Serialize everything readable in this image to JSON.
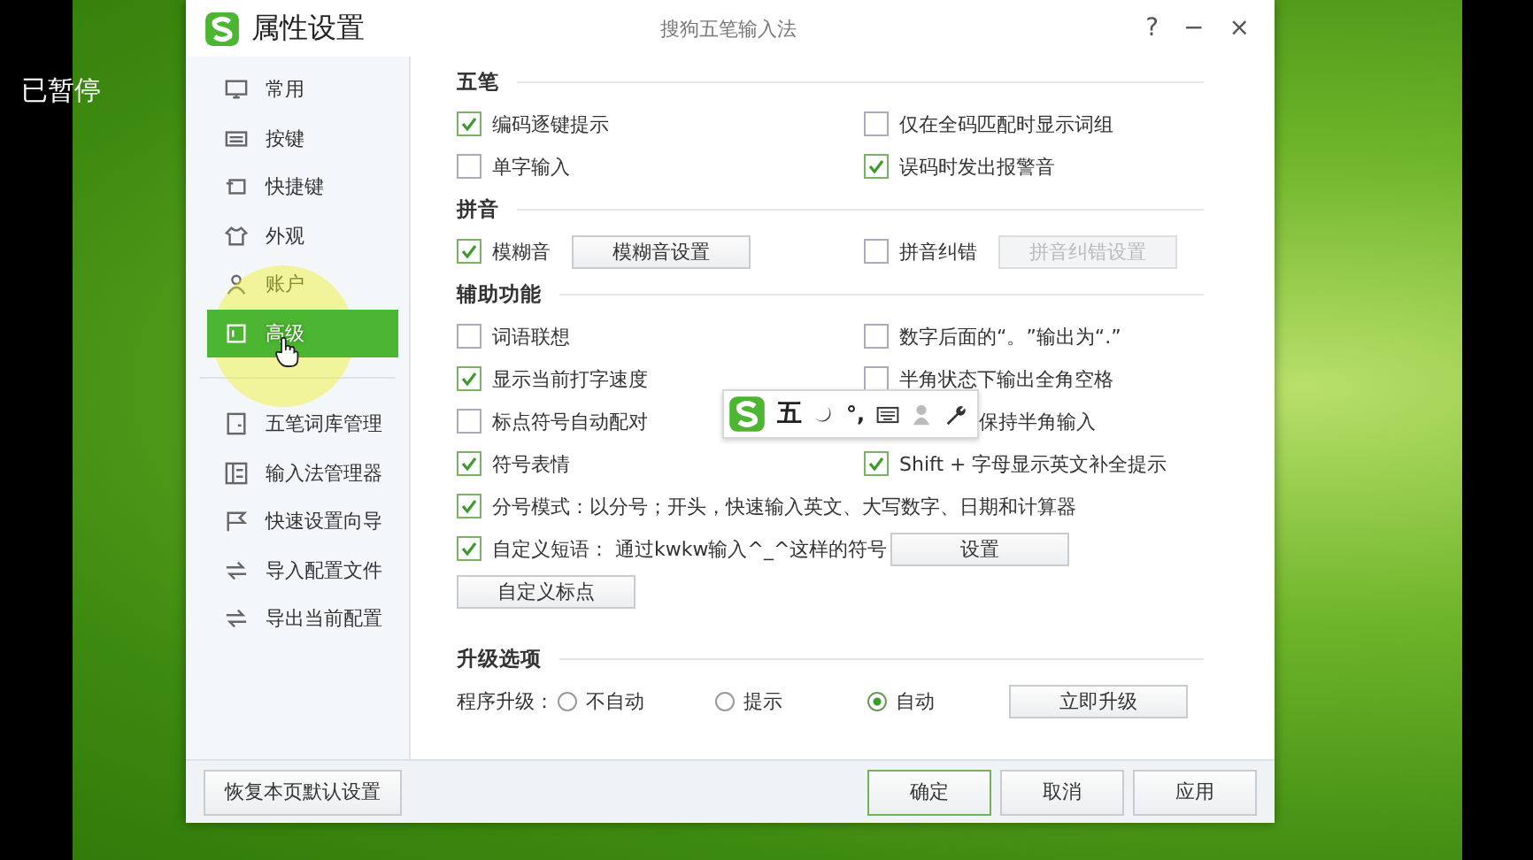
{
  "overlay_text": "已暂停",
  "window": {
    "title": "属性设置",
    "subtitle": "搜狗五笔输入法",
    "controls": [
      "?",
      "−",
      "×"
    ]
  },
  "sidebar": {
    "groups": [
      [
        {
          "label": "常用",
          "selected": false
        },
        {
          "label": "按键",
          "selected": false
        },
        {
          "label": "快捷键",
          "selected": false
        },
        {
          "label": "外观",
          "selected": false
        },
        {
          "label": "账户",
          "selected": false
        },
        {
          "label": "高级",
          "selected": true
        }
      ],
      [
        {
          "label": "五笔词库管理",
          "selected": false
        },
        {
          "label": "输入法管理器",
          "selected": false
        },
        {
          "label": "快速设置向导",
          "selected": false
        },
        {
          "label": "导入配置文件",
          "selected": false
        },
        {
          "label": "导出当前配置",
          "selected": false
        }
      ]
    ]
  },
  "sections": [
    {
      "title": "五笔",
      "rows": [
        [
          {
            "kind": "checkbox",
            "label": "编码逐键提示",
            "checked": true
          },
          {
            "kind": "checkbox",
            "label": "仅在全码匹配时显示词组",
            "checked": false
          }
        ],
        [
          {
            "kind": "checkbox",
            "label": "单字输入",
            "checked": false
          },
          {
            "kind": "checkbox",
            "label": "误码时发出报警音",
            "checked": true
          }
        ]
      ]
    },
    {
      "title": "拼音",
      "rows": [
        [
          {
            "kind": "checkbox",
            "label": "模糊音",
            "checked": true,
            "button": {
              "label": "模糊音设置",
              "disabled": false
            }
          },
          {
            "kind": "checkbox",
            "label": "拼音纠错",
            "checked": false,
            "button": {
              "label": "拼音纠错设置",
              "disabled": true
            }
          }
        ]
      ]
    },
    {
      "title": "辅助功能",
      "rows": [
        [
          {
            "kind": "checkbox",
            "label": "词语联想",
            "checked": false
          },
          {
            "kind": "checkbox",
            "label": "数字后面的“。”输出为“.”",
            "checked": false
          }
        ],
        [
          {
            "kind": "checkbox",
            "label": "显示当前打字速度",
            "checked": true
          },
          {
            "kind": "checkbox",
            "label": "半角状态下输出全角空格",
            "checked": false
          }
        ],
        [
          {
            "kind": "checkbox",
            "label": "标点符号自动配对",
            "checked": false
          },
          {
            "kind": "covered",
            "label": "保持半角输入"
          }
        ],
        [
          {
            "kind": "checkbox",
            "label": "符号表情",
            "checked": true
          },
          {
            "kind": "checkbox",
            "label": "Shift + 字母显示英文补全提示",
            "checked": true
          }
        ],
        [
          {
            "kind": "checkbox",
            "label": "分号模式：以分号；开头，快速输入英文、大写数字、日期和计算器",
            "checked": true
          }
        ],
        [
          {
            "kind": "checkbox",
            "label": "自定义短语： 通过kwkw输入^_^这样的符号",
            "checked": true
          },
          {
            "kind": "button",
            "label": "设置"
          }
        ],
        [
          {
            "kind": "button",
            "label": "自定义标点"
          }
        ]
      ]
    },
    {
      "title": "升级选项",
      "rows": [
        [
          {
            "kind": "radio-group",
            "label": "程序升级：",
            "options": [
              {
                "label": "不自动",
                "selected": false
              },
              {
                "label": "提示",
                "selected": false
              },
              {
                "label": "自动",
                "selected": true
              }
            ],
            "button": {
              "label": "立即升级",
              "disabled": false
            }
          }
        ]
      ]
    }
  ],
  "ime_toolbar": {
    "mode": "五",
    "punct": "°,"
  },
  "footer": {
    "reset": "恢复本页默认设置",
    "buttons": [
      {
        "label": "确定",
        "default": true
      },
      {
        "label": "取消",
        "default": false
      },
      {
        "label": "应用",
        "default": false
      }
    ]
  }
}
